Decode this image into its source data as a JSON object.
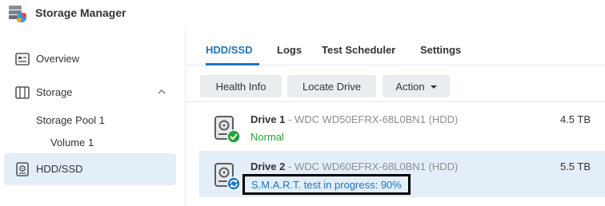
{
  "app": {
    "title": "Storage Manager"
  },
  "sidebar": {
    "items": [
      {
        "label": "Overview",
        "icon": "overview-icon"
      },
      {
        "label": "Storage",
        "icon": "storage-icon",
        "expanded": true
      },
      {
        "label": "HDD/SSD",
        "icon": "hdd-icon",
        "selected": true
      }
    ],
    "storage_children": [
      {
        "label": "Storage Pool 1"
      },
      {
        "label": "Volume 1"
      }
    ]
  },
  "tabs": [
    {
      "label": "HDD/SSD",
      "active": true
    },
    {
      "label": "Logs"
    },
    {
      "label": "Test Scheduler"
    },
    {
      "label": "Settings"
    }
  ],
  "toolbar": {
    "health_info": "Health Info",
    "locate_drive": "Locate Drive",
    "action": "Action"
  },
  "drives": [
    {
      "name": "Drive 1",
      "separator": " - ",
      "model": "WDC WD50EFRX-68L0BN1 (HDD)",
      "size": "4.5 TB",
      "status": "Normal",
      "status_icon": "check-badge-icon"
    },
    {
      "name": "Drive 2",
      "separator": " - ",
      "model": "WDC WD60EFRX-68L0BN1 (HDD)",
      "size": "5.5 TB",
      "status": "S.M.A.R.T. test in progress: 90%",
      "status_icon": "sync-badge-icon"
    }
  ],
  "colors": {
    "accent": "#1c75bc",
    "ok": "#23a33a",
    "selected_bg": "#e4eef8",
    "button_bg": "#e9edf0"
  }
}
